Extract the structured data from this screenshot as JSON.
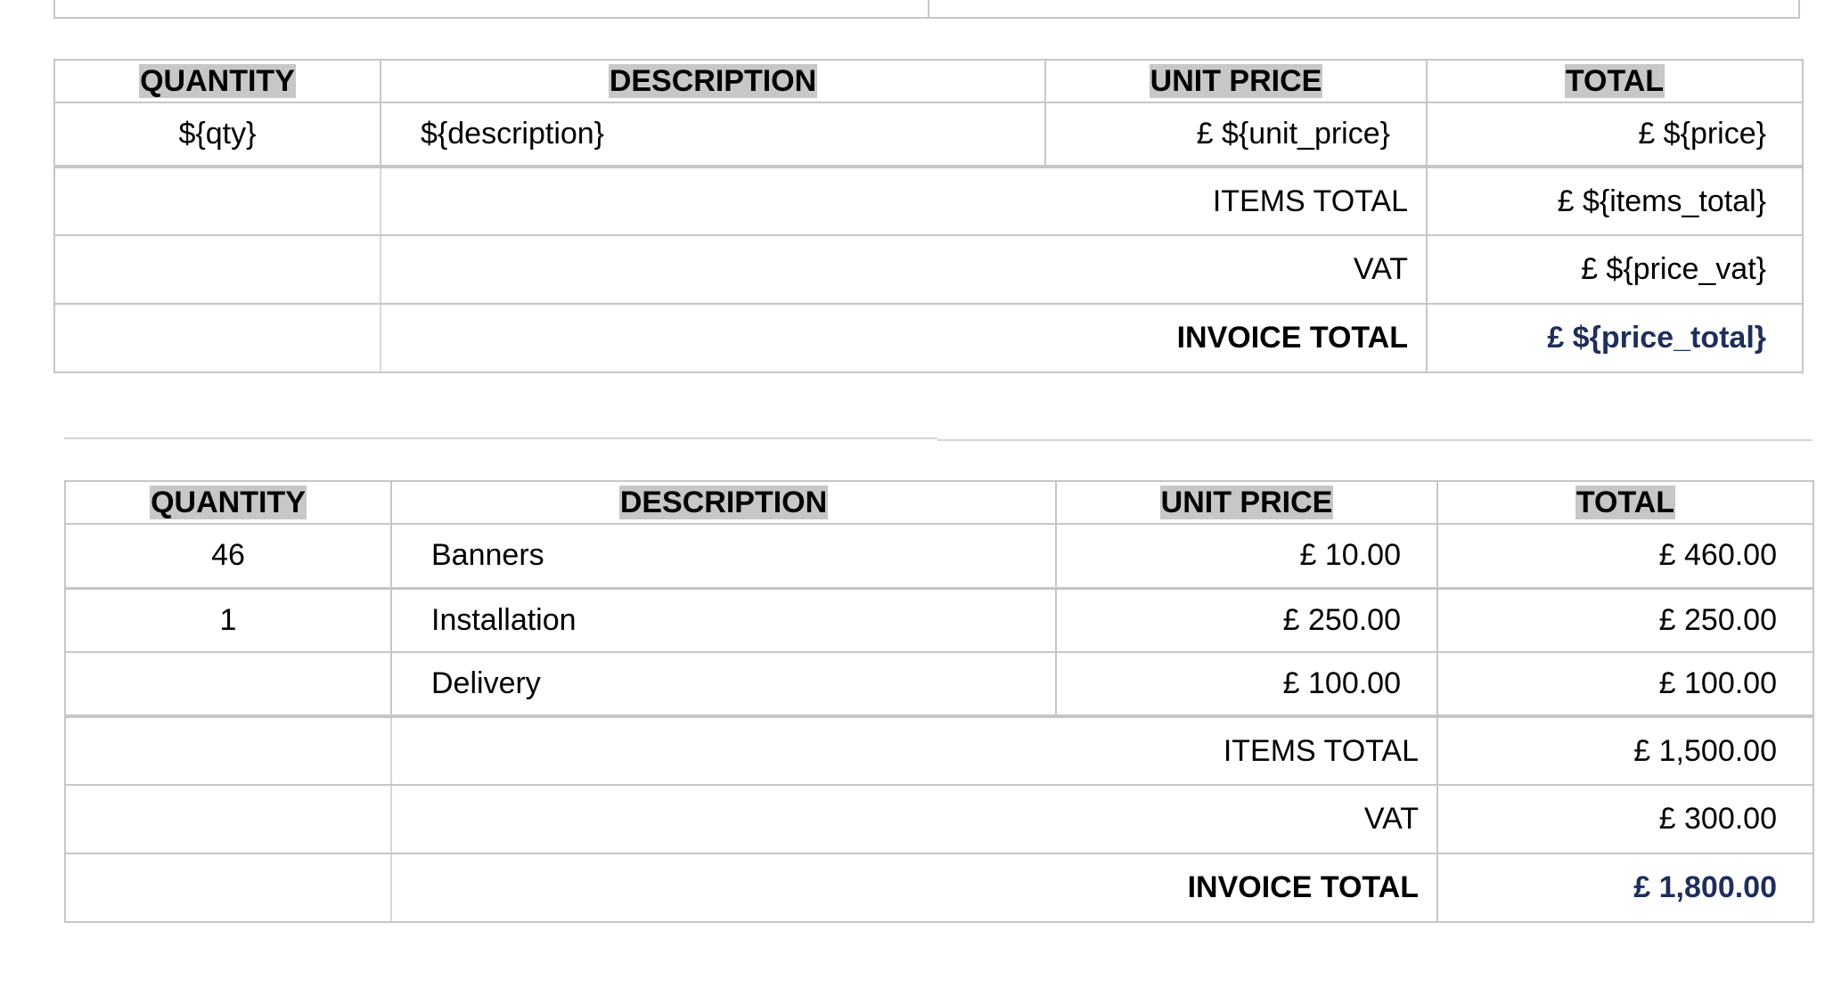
{
  "template_table": {
    "headers": {
      "quantity": "QUANTITY",
      "description": "DESCRIPTION",
      "unit_price": "UNIT PRICE",
      "total": "TOTAL"
    },
    "item": {
      "qty": "${qty}",
      "description": "${description}",
      "unit_price": "£ ${unit_price}",
      "price": "£ ${price}"
    },
    "summary": {
      "items_total_label": "ITEMS TOTAL",
      "items_total_value": "£ ${items_total}",
      "vat_label": "VAT",
      "vat_value": "£ ${price_vat}",
      "invoice_total_label": "INVOICE TOTAL",
      "invoice_total_value": "£ ${price_total}"
    }
  },
  "filled_table": {
    "headers": {
      "quantity": "QUANTITY",
      "description": "DESCRIPTION",
      "unit_price": "UNIT PRICE",
      "total": "TOTAL"
    },
    "items": [
      {
        "qty": "46",
        "description": "Banners",
        "unit_price": "£ 10.00",
        "price": "£ 460.00"
      },
      {
        "qty": "1",
        "description": "Installation",
        "unit_price": "£ 250.00",
        "price": "£ 250.00"
      },
      {
        "qty": "",
        "description": "Delivery",
        "unit_price": "£ 100.00",
        "price": "£ 100.00"
      }
    ],
    "summary": {
      "items_total_label": "ITEMS TOTAL",
      "items_total_value": "£ 1,500.00",
      "vat_label": "VAT",
      "vat_value": "£ 300.00",
      "invoice_total_label": "INVOICE TOTAL",
      "invoice_total_value": "£ 1,800.00"
    }
  },
  "colors": {
    "header_highlight": "#c7c7c7",
    "invoice_total_text": "#1f2f5c",
    "border": "#c6c6c6"
  }
}
